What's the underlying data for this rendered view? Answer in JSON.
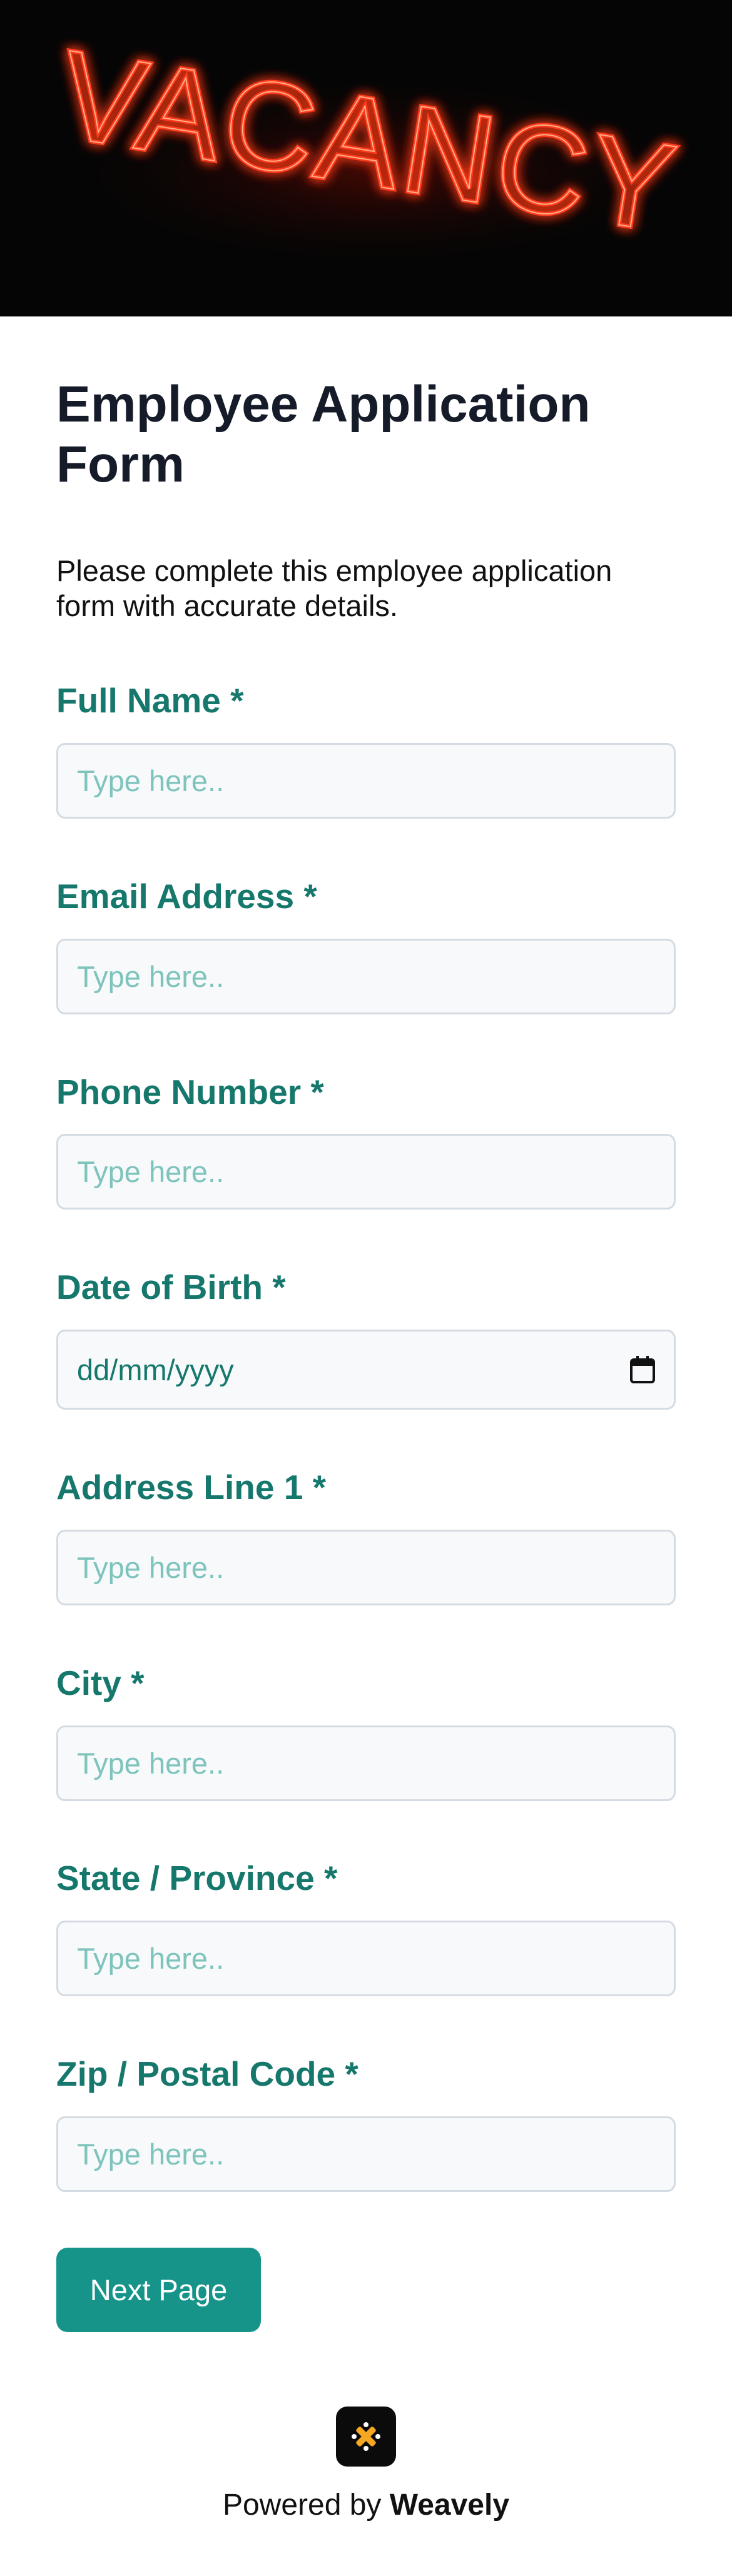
{
  "hero": {
    "image_icon": "neon-vacancy-sign",
    "sign_text": "VACANCY",
    "glow_color": "#ff3a1a"
  },
  "form": {
    "title": "Employee Application Form",
    "description": "Please complete this employee application form with accurate details.",
    "fields": [
      {
        "label": "Full Name *",
        "placeholder": "Type here.."
      },
      {
        "label": "Email Address *",
        "placeholder": "Type here.."
      },
      {
        "label": "Phone Number *",
        "placeholder": "Type here.."
      },
      {
        "label": "Date of Birth *",
        "placeholder": "dd/mm/yyyy",
        "icon": "calendar-icon"
      },
      {
        "label": "Address Line 1 *",
        "placeholder": "Type here.."
      },
      {
        "label": "City *",
        "placeholder": "Type here.."
      },
      {
        "label": "State / Province *",
        "placeholder": "Type here.."
      },
      {
        "label": "Zip / Postal Code *",
        "placeholder": "Type here.."
      }
    ],
    "next_button": "Next Page"
  },
  "footer": {
    "logo_icon": "weavely-logo-icon",
    "powered_prefix": "Powered by",
    "brand": "Weavely"
  },
  "colors": {
    "accent": "#16786c",
    "button": "#16948a",
    "placeholder": "#7ec4bc",
    "title": "#161b2a"
  }
}
